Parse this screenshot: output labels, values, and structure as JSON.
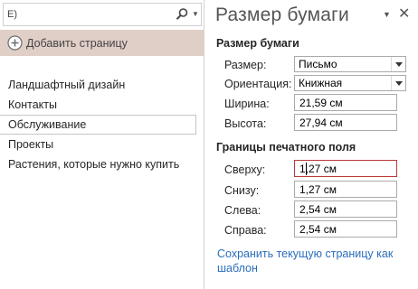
{
  "left_pane": {
    "search": {
      "value": "E)",
      "icons": [
        "search-icon",
        "dropdown-arrow-icon"
      ]
    },
    "add_page_label": "Добавить страницу",
    "pages": [
      {
        "label": "Ландшафтный дизайн",
        "selected": false
      },
      {
        "label": "Контакты",
        "selected": false
      },
      {
        "label": "Обслуживание",
        "selected": true
      },
      {
        "label": "Проекты",
        "selected": false
      },
      {
        "label": "Растения, которые нужно купить",
        "selected": false
      }
    ]
  },
  "paper_pane": {
    "title": "Размер бумаги",
    "menu_icon": "▼",
    "close_icon": "✕",
    "paper_section": {
      "heading": "Размер бумаги",
      "size_label": "Размер:",
      "size_value": "Письмо",
      "orientation_label": "Ориентация:",
      "orientation_value": "Книжная",
      "width_label": "Ширина:",
      "width_value": "21,59 см",
      "height_label": "Высота:",
      "height_value": "27,94 см"
    },
    "margins_section": {
      "heading": "Границы печатного поля",
      "top_label": "Сверху:",
      "top_value": "1,27 см",
      "bottom_label": "Снизу:",
      "bottom_value": "1,27 см",
      "left_label": "Слева:",
      "left_value": "2,54 см",
      "right_label": "Справа:",
      "right_value": "2,54 см"
    },
    "save_link": "Сохранить текущую страницу как шаблон"
  },
  "colors": {
    "add_page_bg": "#e0cfc7",
    "active_border": "#b83b35",
    "link": "#2a6ebb"
  }
}
